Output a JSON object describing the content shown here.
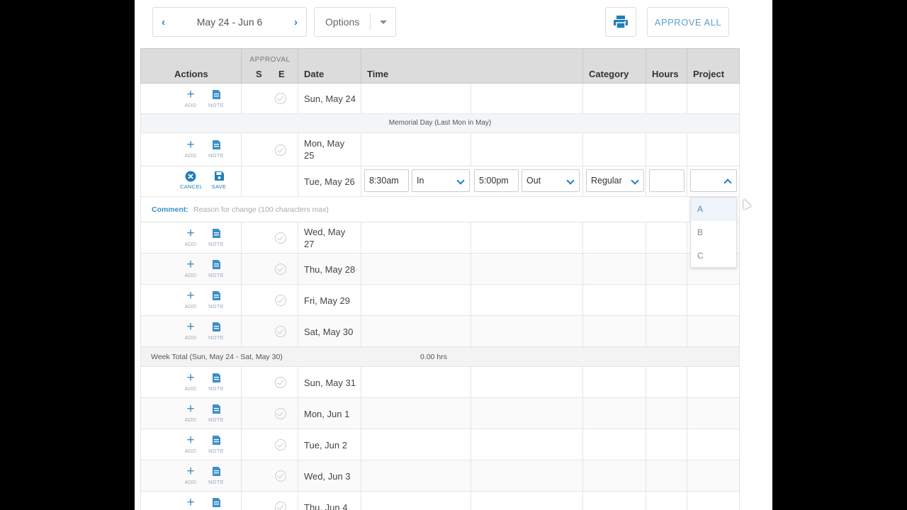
{
  "toolbar": {
    "date_range": "May 24 - Jun 6",
    "prev_icon": "chevron-left-icon",
    "next_icon": "chevron-right-icon",
    "options_label": "Options",
    "approve_all_label": "APPROVE ALL",
    "accent_color": "#1f7fb6"
  },
  "table": {
    "headers": {
      "actions": "Actions",
      "approval": "APPROVAL",
      "approval_s": "S",
      "approval_e": "E",
      "date": "Date",
      "time": "Time",
      "category": "Category",
      "hours": "Hours",
      "project": "Project"
    },
    "action_labels": {
      "add": "ADD",
      "note": "NOTE",
      "cancel": "CANCEL",
      "save": "SAVE"
    },
    "rows": [
      {
        "date": "Sun, May 24"
      },
      {
        "banner": "Memorial Day (Last Mon in May)"
      },
      {
        "date_line1": "Mon, May",
        "date_line2": "25"
      },
      {
        "date": "Tue, May 26",
        "time_in": "8:30am",
        "in_label": "In",
        "time_out": "5:00pm",
        "out_label": "Out",
        "category": "Regular",
        "hours": "",
        "project": ""
      },
      {
        "comment_label": "Comment:",
        "comment_placeholder": "Reason for change (100 characters max)"
      },
      {
        "date_line1": "Wed, May",
        "date_line2": "27"
      },
      {
        "date": "Thu, May 28"
      },
      {
        "date": "Fri, May 29"
      },
      {
        "date": "Sat, May 30"
      },
      {
        "week_total_label": "Week Total (Sun, May 24 - Sat, May 30)",
        "week_total_value": "0.00 hrs"
      },
      {
        "date": "Sun, May 31"
      },
      {
        "date": "Mon, Jun 1"
      },
      {
        "date": "Tue, Jun 2"
      },
      {
        "date": "Wed, Jun 3"
      },
      {
        "date": "Thu, Jun 4"
      }
    ]
  },
  "project_dropdown": {
    "options": [
      "A",
      "B",
      "C"
    ]
  }
}
